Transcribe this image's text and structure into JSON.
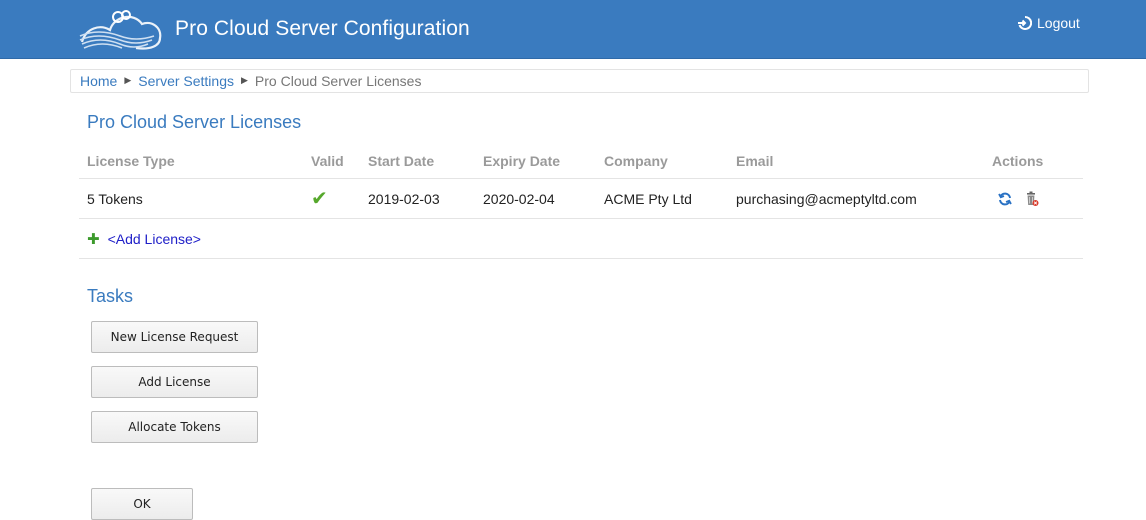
{
  "header": {
    "title": "Pro Cloud Server Configuration",
    "logout_label": "Logout"
  },
  "breadcrumb": {
    "items": [
      "Home",
      "Server Settings",
      "Pro Cloud Server Licenses"
    ]
  },
  "licenses": {
    "title": "Pro Cloud Server Licenses",
    "columns": [
      "License Type",
      "Valid",
      "Start Date",
      "Expiry Date",
      "Company",
      "Email",
      "Actions"
    ],
    "rows": [
      {
        "license_type": "5 Tokens",
        "valid": true,
        "start_date": "2019-02-03",
        "expiry_date": "2020-02-04",
        "company": "ACME Pty Ltd",
        "email": "purchasing@acmeptyltd.com"
      }
    ],
    "add_label": "<Add License>"
  },
  "tasks": {
    "title": "Tasks",
    "buttons": [
      "New License Request",
      "Add License",
      "Allocate Tokens"
    ]
  },
  "footer": {
    "ok_label": "OK"
  },
  "colors": {
    "header_bg": "#3a7bbf",
    "link": "#3a7bbf",
    "add_link": "#2020c8",
    "valid_check": "#56a82c"
  },
  "icons": {
    "logo": "cloud-logo-icon",
    "logout": "logout-icon",
    "valid": "checkmark-icon",
    "refresh": "refresh-icon",
    "delete": "delete-license-icon",
    "add": "plus-icon"
  }
}
